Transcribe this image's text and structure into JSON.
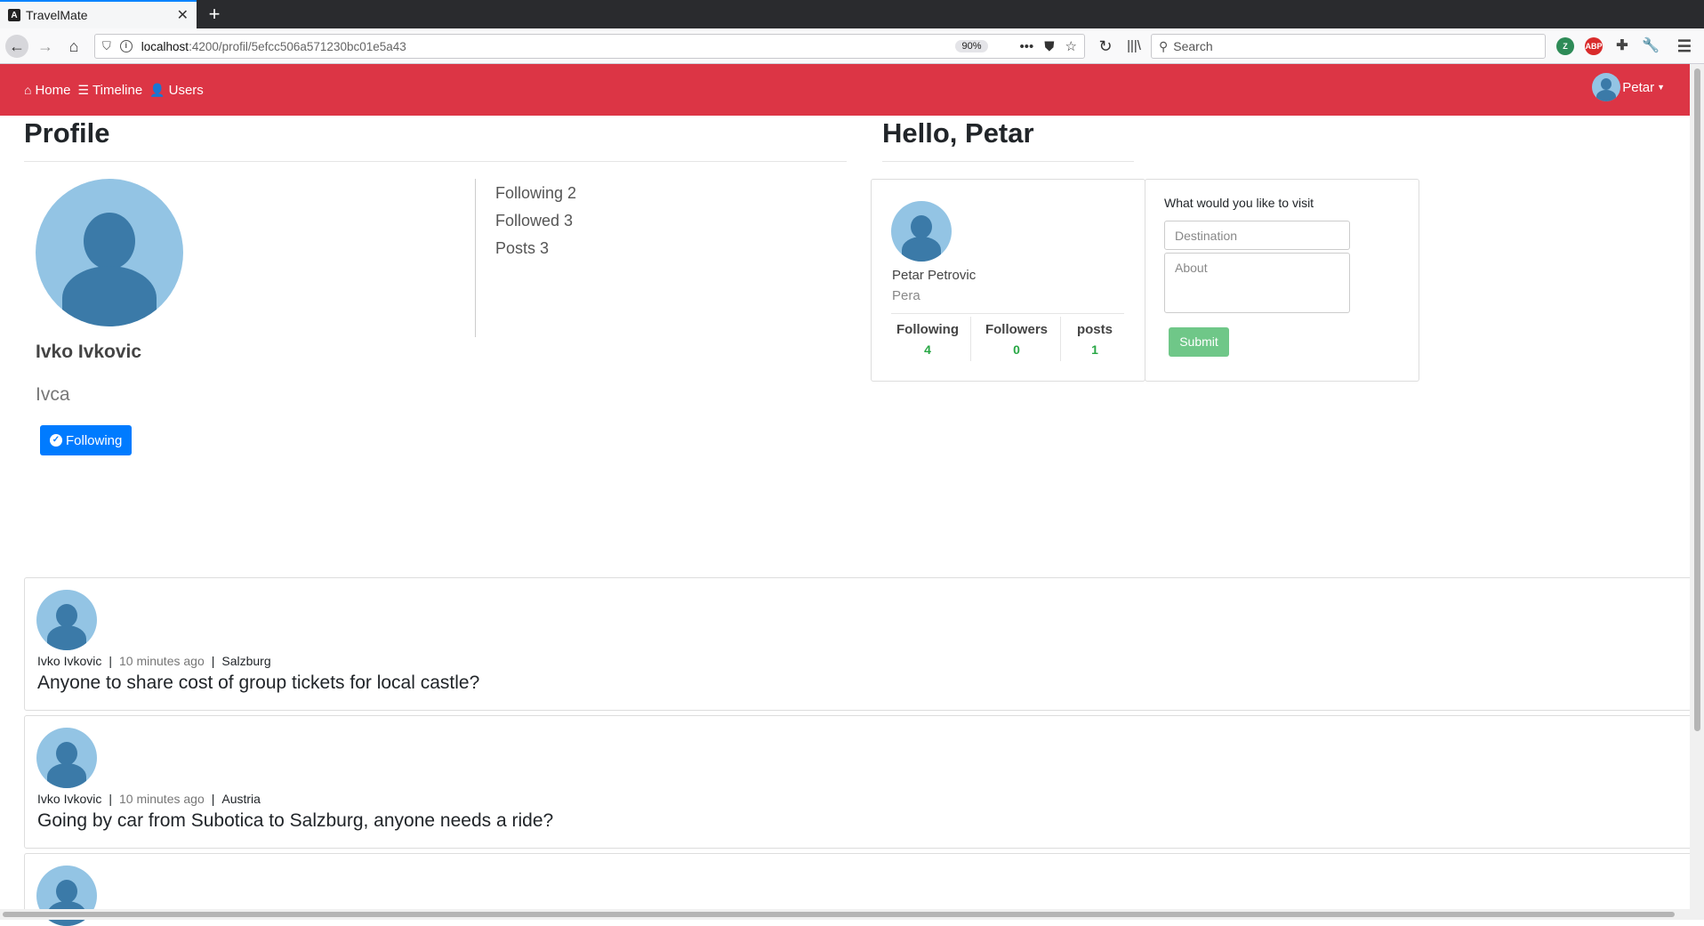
{
  "browser": {
    "tab_title": "TravelMate",
    "url_host": "localhost",
    "url_path": ":4200/profil/5efcc506a571230bc01e5a43",
    "zoom": "90%",
    "search_placeholder": "Search"
  },
  "nav": {
    "home": "Home",
    "timeline": "Timeline",
    "users": "Users",
    "user_menu": "Petar"
  },
  "profile": {
    "title": "Profile",
    "name": "Ivko Ivkovic",
    "nickname": "Ivca",
    "follow_button": "Following",
    "stats": {
      "following": "Following 2",
      "followed": "Followed 3",
      "posts": "Posts 3"
    }
  },
  "hello": {
    "title": "Hello, Petar",
    "user_card": {
      "name": "Petar Petrovic",
      "nickname": "Pera",
      "following_label": "Following",
      "following_value": "4",
      "followers_label": "Followers",
      "followers_value": "0",
      "posts_label": "posts",
      "posts_value": "1"
    },
    "visit_form": {
      "label": "What would you like to visit",
      "destination_placeholder": "Destination",
      "about_placeholder": "About",
      "submit": "Submit"
    }
  },
  "posts": [
    {
      "author": "Ivko Ivkovic",
      "time": "10 minutes ago",
      "location": "Salzburg",
      "text": "Anyone to share cost of group tickets for local castle?"
    },
    {
      "author": "Ivko Ivkovic",
      "time": "10 minutes ago",
      "location": "Austria",
      "text": "Going by car from Subotica to Salzburg, anyone needs a ride?"
    }
  ],
  "colors": {
    "navbar": "#dc3545",
    "primary": "#007bff",
    "success": "#28a745",
    "submit_disabled": "#6fc788",
    "avatar_bg": "#93c4e4",
    "avatar_fg": "#3b7aa8"
  }
}
